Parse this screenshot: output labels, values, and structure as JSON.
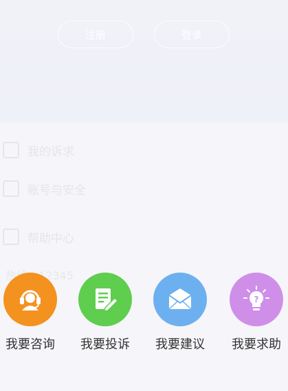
{
  "background": {
    "register_label": "注册",
    "login_label": "登录",
    "menu": [
      {
        "label": "我的诉求",
        "icon": "document-icon"
      },
      {
        "label": "账号与安全",
        "icon": "lock-icon"
      },
      {
        "label": "帮助中心",
        "icon": "book-icon"
      }
    ],
    "hotline": "热线：12345"
  },
  "actions": [
    {
      "label": "我要咨询",
      "icon": "headset-agent-icon",
      "color": "#f3921f"
    },
    {
      "label": "我要投诉",
      "icon": "edit-document-icon",
      "color": "#5fcd4d"
    },
    {
      "label": "我要建议",
      "icon": "envelope-icon",
      "color": "#6db0ef"
    },
    {
      "label": "我要求助",
      "icon": "lightbulb-question-icon",
      "color": "#cf8fe9"
    }
  ]
}
